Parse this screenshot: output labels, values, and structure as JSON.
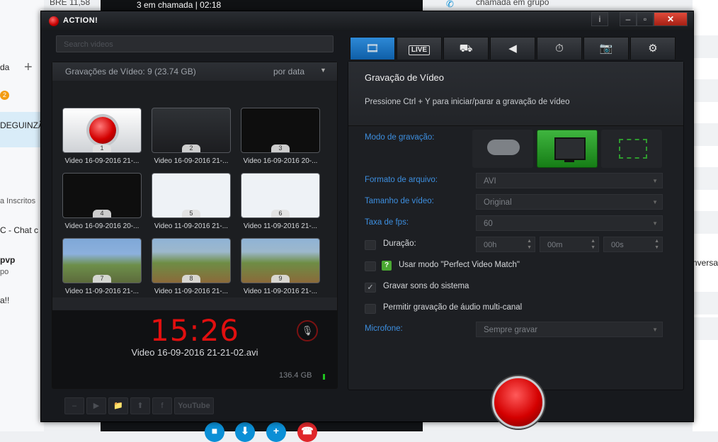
{
  "background": {
    "top_left_text": "BRE 11,58",
    "call_status": "3 em chamada | 02:18",
    "group_call_text": "chamada em grupo",
    "left_items": [
      "da",
      "DEGUINZÃ",
      "a Inscritos",
      "C - Chat c",
      "pvp",
      "po",
      "a!!"
    ],
    "badge_count": "2",
    "right_text": "nversa"
  },
  "app": {
    "title": "ACTION!",
    "window_buttons": {
      "info": "i",
      "minimize": "–",
      "restore": "▫",
      "close": "✕"
    },
    "search_placeholder": "Search videos",
    "library": {
      "count_label": "Gravações de Vídeo: 9 (23.74 GB)",
      "sort_label": "por data",
      "thumbnails": [
        {
          "num": "1",
          "caption": "Video 16-09-2016 21-...",
          "kind": "rec"
        },
        {
          "num": "2",
          "caption": "Video 16-09-2016 21-...",
          "kind": "desk"
        },
        {
          "num": "3",
          "caption": "Video 16-09-2016 20-...",
          "kind": "code"
        },
        {
          "num": "4",
          "caption": "Video 16-09-2016 20-...",
          "kind": "code"
        },
        {
          "num": "5",
          "caption": "Video 11-09-2016 21-...",
          "kind": "skype"
        },
        {
          "num": "6",
          "caption": "Video 11-09-2016 21-...",
          "kind": "skype"
        },
        {
          "num": "7",
          "caption": "Video 11-09-2016 21-...",
          "kind": "mine"
        },
        {
          "num": "8",
          "caption": "Video 11-09-2016 21-...",
          "kind": "mine2"
        },
        {
          "num": "9",
          "caption": "Video 11-09-2016 21-...",
          "kind": "mine2"
        }
      ],
      "timer": "15:26",
      "filename": "Video 16-09-2016 21-21-02.avi",
      "disk_free": "136.4 GB"
    },
    "bottom_tools": [
      "–",
      "▶",
      "📁",
      "⬆",
      "f",
      "YouTube"
    ],
    "tabs": [
      {
        "name": "video",
        "icon": "🎞"
      },
      {
        "name": "live",
        "icon": "LIVE"
      },
      {
        "name": "benchmark",
        "icon": "⛟"
      },
      {
        "name": "audio",
        "icon": "◀"
      },
      {
        "name": "timer",
        "icon": "⏱"
      },
      {
        "name": "screenshot",
        "icon": "📷"
      },
      {
        "name": "settings",
        "icon": "⚙"
      }
    ],
    "panel": {
      "title": "Gravação de Vídeo",
      "hint": "Pressione Ctrl + Y para iniciar/parar a gravação de vídeo",
      "mode_label": "Modo de gravação:",
      "format_label": "Formato de arquivo:",
      "format_value": "AVI",
      "size_label": "Tamanho de vídeo:",
      "size_value": "Original",
      "fps_label": "Taxa de fps:",
      "fps_value": "60",
      "duration_label": "Duração:",
      "duration_h": "00h",
      "duration_m": "00m",
      "duration_s": "00s",
      "perfect_match_label": "Usar modo \"Perfect Video Match\"",
      "system_sounds_label": "Gravar sons do sistema",
      "multichannel_label": "Permitir gravação de áudio multi-canal",
      "mic_label": "Microfone:",
      "mic_value": "Sempre gravar"
    }
  }
}
